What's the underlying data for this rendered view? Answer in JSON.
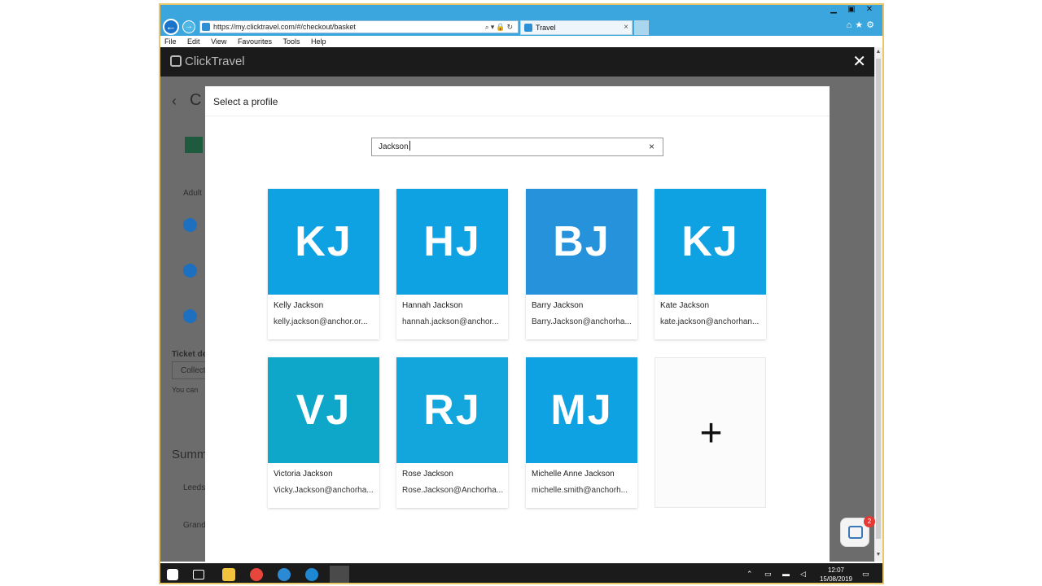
{
  "browser": {
    "url": "https://my.clicktravel.com/#/checkout/basket",
    "tab_title": "Travel",
    "menu": [
      "File",
      "Edit",
      "View",
      "Favourites",
      "Tools",
      "Help"
    ]
  },
  "app": {
    "brand": "ClickTravel"
  },
  "background_fragments": {
    "back_char": "‹",
    "title_char": "C",
    "adult": "Adult",
    "ticket": "Ticket de",
    "collect": "Collect",
    "you_can": "You can",
    "summary": "Summ",
    "leeds": "Leeds",
    "grand": "Grand"
  },
  "modal": {
    "title": "Select a profile",
    "search_value": "Jackson",
    "clear_icon": "×"
  },
  "profiles": [
    {
      "initials": "KJ",
      "name": "Kelly Jackson",
      "email": "kelly.jackson@anchor.or...",
      "color": "#0fa2e3"
    },
    {
      "initials": "HJ",
      "name": "Hannah Jackson",
      "email": "hannah.jackson@anchor...",
      "color": "#0fa2e3"
    },
    {
      "initials": "BJ",
      "name": "Barry Jackson",
      "email": "Barry.Jackson@anchorha...",
      "color": "#2592db"
    },
    {
      "initials": "KJ",
      "name": "Kate Jackson",
      "email": "kate.jackson@anchorhan...",
      "color": "#0fa2e3"
    },
    {
      "initials": "VJ",
      "name": "Victoria Jackson",
      "email": "Vicky.Jackson@anchorha...",
      "color": "#0ea6c9"
    },
    {
      "initials": "RJ",
      "name": "Rose Jackson",
      "email": "Rose.Jackson@Anchorha...",
      "color": "#13a6dc"
    },
    {
      "initials": "MJ",
      "name": "Michelle Anne Jackson",
      "email": "michelle.smith@anchorh...",
      "color": "#0fa2e3"
    }
  ],
  "add_profile": {
    "label": "+"
  },
  "chat": {
    "badge": "2"
  },
  "taskbar": {
    "time": "12:07",
    "date": "15/08/2019"
  }
}
